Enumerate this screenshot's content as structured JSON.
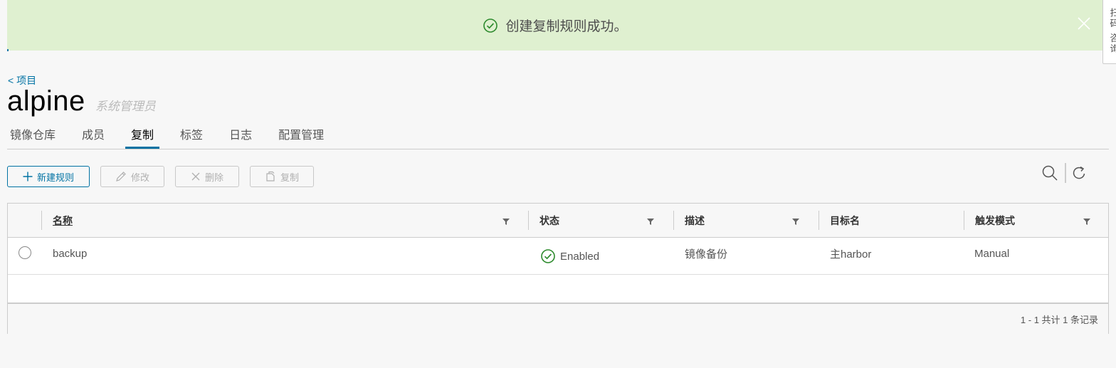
{
  "banner": {
    "message": "创建复制规则成功。",
    "icon": "check-circle-icon",
    "color": "#dff0d0"
  },
  "side_tab": {
    "label": "扫码 咨询"
  },
  "header": {
    "back_link": "< 项目",
    "project_name": "alpine",
    "role": "系统管理员"
  },
  "tabs": [
    {
      "label": "镜像仓库"
    },
    {
      "label": "成员"
    },
    {
      "label": "复制",
      "active": true
    },
    {
      "label": "标签"
    },
    {
      "label": "日志"
    },
    {
      "label": "配置管理"
    }
  ],
  "toolbar": {
    "new_rule": "新建规则",
    "edit": "修改",
    "delete": "删除",
    "copy": "复制"
  },
  "grid": {
    "columns": [
      "名称",
      "状态",
      "描述",
      "目标名",
      "触发模式"
    ],
    "rows": [
      {
        "name": "backup",
        "status": "Enabled",
        "description": "镜像备份",
        "target": "主harbor",
        "trigger": "Manual"
      }
    ],
    "footer": "1 - 1 共计 1 条记录"
  },
  "colors": {
    "accent": "#0072a3",
    "success": "#2e8b2e"
  }
}
